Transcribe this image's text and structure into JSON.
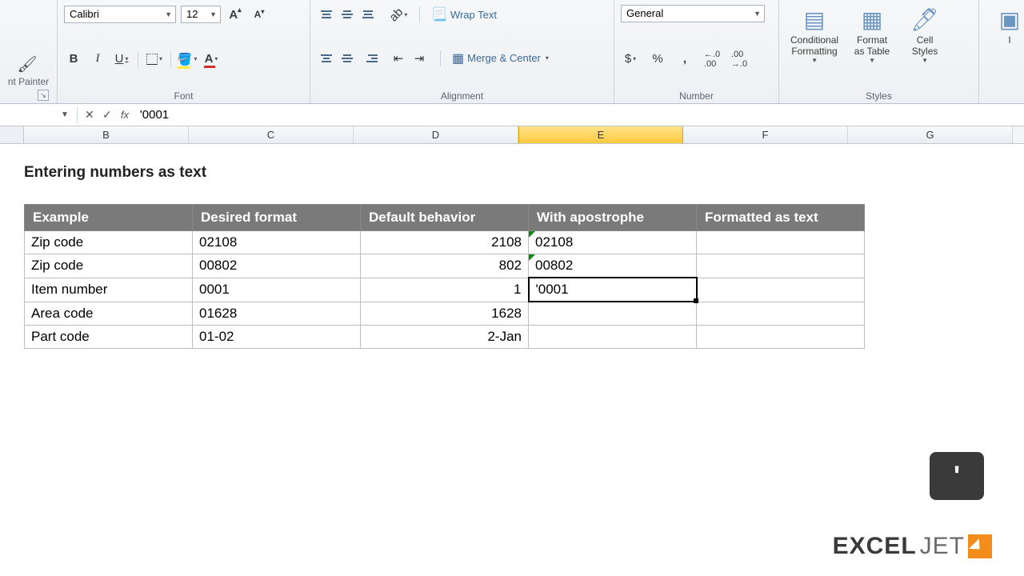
{
  "ribbon": {
    "clipboard": {
      "painter": "nt Painter"
    },
    "font": {
      "name": "Calibri",
      "size": "12",
      "group_label": "Font",
      "bold": "B",
      "italic": "I",
      "underline": "U"
    },
    "alignment": {
      "group_label": "Alignment",
      "wrap": "Wrap Text",
      "merge": "Merge & Center"
    },
    "number": {
      "group_label": "Number",
      "format": "General",
      "currency": "$",
      "percent": "%",
      "comma": ","
    },
    "styles": {
      "group_label": "Styles",
      "cond": "Conditional\nFormatting",
      "table": "Format\nas Table",
      "cell": "Cell\nStyles"
    }
  },
  "formula_bar": {
    "value": "'0001"
  },
  "columns": [
    "B",
    "C",
    "D",
    "E",
    "F",
    "G"
  ],
  "active_column": "E",
  "sheet": {
    "title": "Entering numbers as text",
    "headers": [
      "Example",
      "Desired format",
      "Default behavior",
      "With apostrophe",
      "Formatted as text"
    ],
    "rows": [
      {
        "ex": "Zip code",
        "df": "02108",
        "db": "2108",
        "wa": "02108",
        "ft": "",
        "tri": true
      },
      {
        "ex": "Zip code",
        "df": "00802",
        "db": "802",
        "wa": "00802",
        "ft": "",
        "tri": true
      },
      {
        "ex": "Item number",
        "df": "0001",
        "db": "1",
        "wa": "'0001",
        "ft": "",
        "editing": true
      },
      {
        "ex": "Area code",
        "df": "01628",
        "db": "1628",
        "wa": "",
        "ft": ""
      },
      {
        "ex": "Part code",
        "df": "01-02",
        "db": "2-Jan",
        "wa": "",
        "ft": ""
      }
    ]
  },
  "keycap": "'",
  "logo": {
    "a": "EXCEL",
    "b": "JET"
  }
}
